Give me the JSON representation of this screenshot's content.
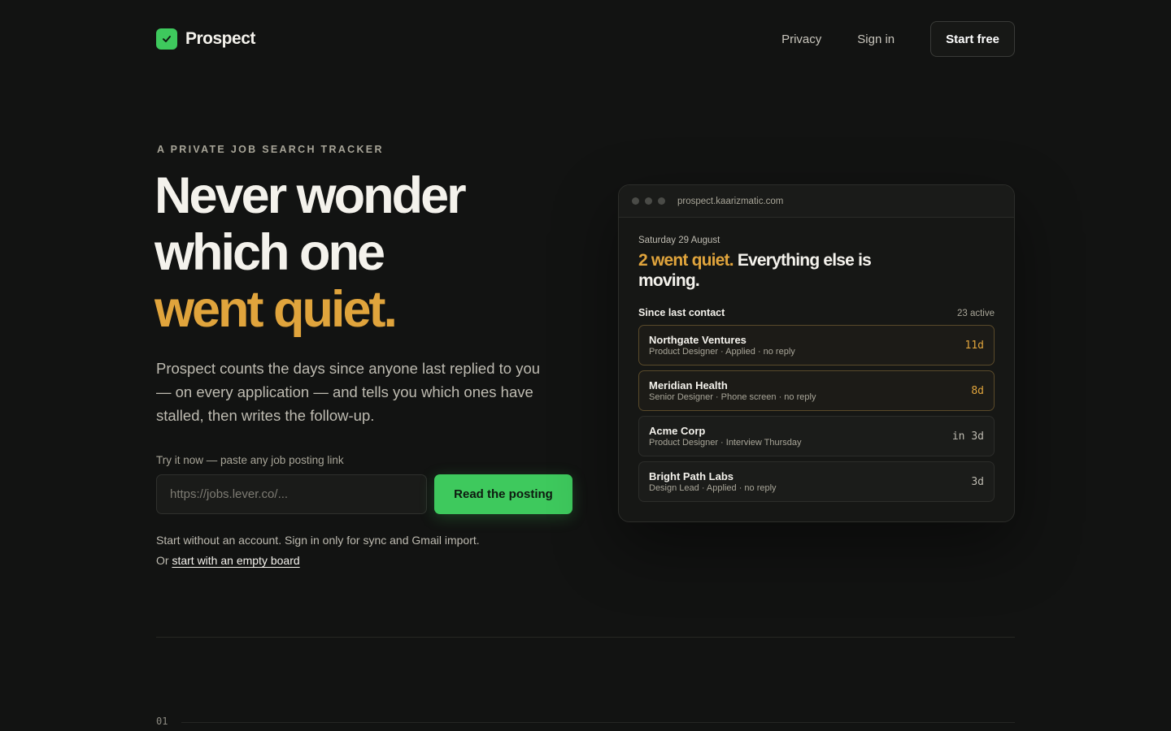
{
  "nav": {
    "brand": "Prospect",
    "links": [
      "Privacy",
      "Sign in"
    ],
    "cta": "Start free"
  },
  "hero": {
    "eyebrow": "A PRIVATE JOB SEARCH TRACKER",
    "headline_line1": "Never wonder",
    "headline_line2": "which one",
    "headline_accent": "went quiet.",
    "lede": "Prospect counts the days since anyone last replied to you — on every application — and tells you which ones have stalled, then writes the follow-up.",
    "try_label": "Try it now — paste any job posting link",
    "input_placeholder": "https://jobs.lever.co/...",
    "button": "Read the posting",
    "note": "Start without an account. Sign in only for sync and Gmail import.",
    "alt_prefix": "Or ",
    "alt_link": "start with an empty board"
  },
  "preview": {
    "url": "prospect.kaarizmatic.com",
    "date": "Saturday 29 August",
    "headline_accent": "2 went quiet.",
    "headline_rest": " Everything else is moving.",
    "section_title": "Since last contact",
    "section_count": "23 active",
    "rows": [
      {
        "name": "Northgate Ventures",
        "meta": "Product Designer · Applied · no reply",
        "days": "11d",
        "stalled": true
      },
      {
        "name": "Meridian Health",
        "meta": "Senior Designer · Phone screen · no reply",
        "days": "8d",
        "stalled": true
      },
      {
        "name": "Acme Corp",
        "meta": "Product Designer · Interview Thursday",
        "days": "in 3d",
        "stalled": false
      },
      {
        "name": "Bright Path Labs",
        "meta": "Design Lead · Applied · no reply",
        "days": "3d",
        "stalled": false
      }
    ]
  },
  "section": {
    "number": "01"
  },
  "colors": {
    "accent_green": "#3ec95d",
    "accent_amber": "#e0a43c",
    "background": "#121312"
  }
}
